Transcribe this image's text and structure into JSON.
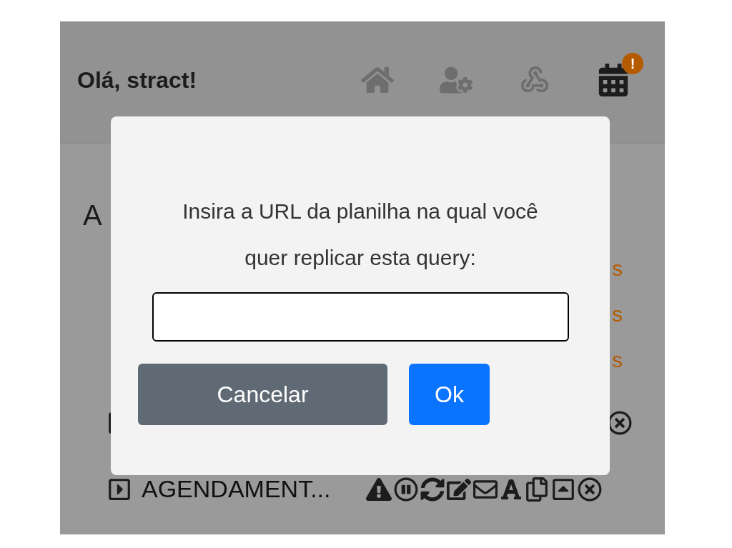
{
  "header": {
    "greeting": "Olá, stract!",
    "badge": "!",
    "nav_icons": [
      {
        "kind": "home",
        "selected": false
      },
      {
        "kind": "user-settings",
        "selected": false
      },
      {
        "kind": "webhook",
        "selected": false
      },
      {
        "kind": "calendar",
        "selected": true
      }
    ]
  },
  "page": {
    "heading": "A",
    "links": [
      "s",
      "s",
      "s"
    ],
    "rows": [
      {
        "name": "AGENDAMENT..."
      }
    ]
  },
  "dialog": {
    "message": "Insira a URL da planilha na qual você quer replicar esta query:",
    "buttons": [
      {
        "label": "Cancelar",
        "kind": "secondary"
      },
      {
        "label": "Ok",
        "kind": "primary"
      }
    ]
  }
}
